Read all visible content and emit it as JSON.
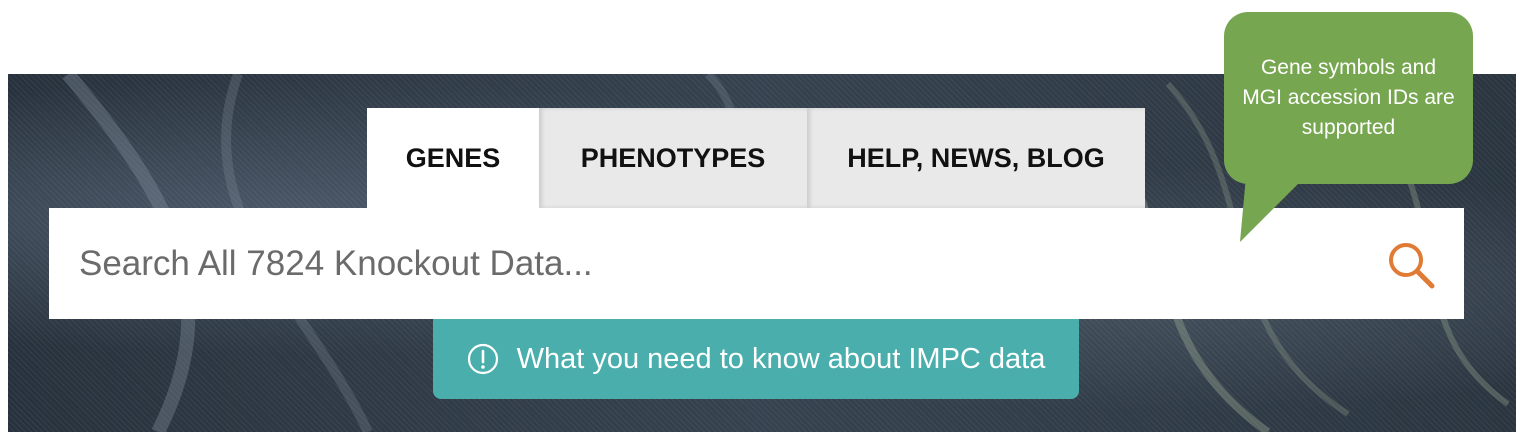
{
  "tabs": [
    {
      "label": "GENES",
      "active": true
    },
    {
      "label": "PHENOTYPES",
      "active": false
    },
    {
      "label": "HELP, NEWS, BLOG",
      "active": false
    }
  ],
  "search": {
    "placeholder": "Search All 7824 Knockout Data...",
    "value": "",
    "icon": "search-icon"
  },
  "info_button": {
    "label": "What you need to know about IMPC data",
    "icon": "exclamation-circle-icon"
  },
  "tooltip": {
    "lines": [
      "Gene symbols and",
      "MGI accession IDs are",
      "supported"
    ]
  },
  "colors": {
    "banner": "#2e3a47",
    "tab_inactive": "#e9e9e9",
    "accent_search_icon": "#e07b35",
    "info_button": "#4aaead",
    "tooltip": "#77a651"
  }
}
